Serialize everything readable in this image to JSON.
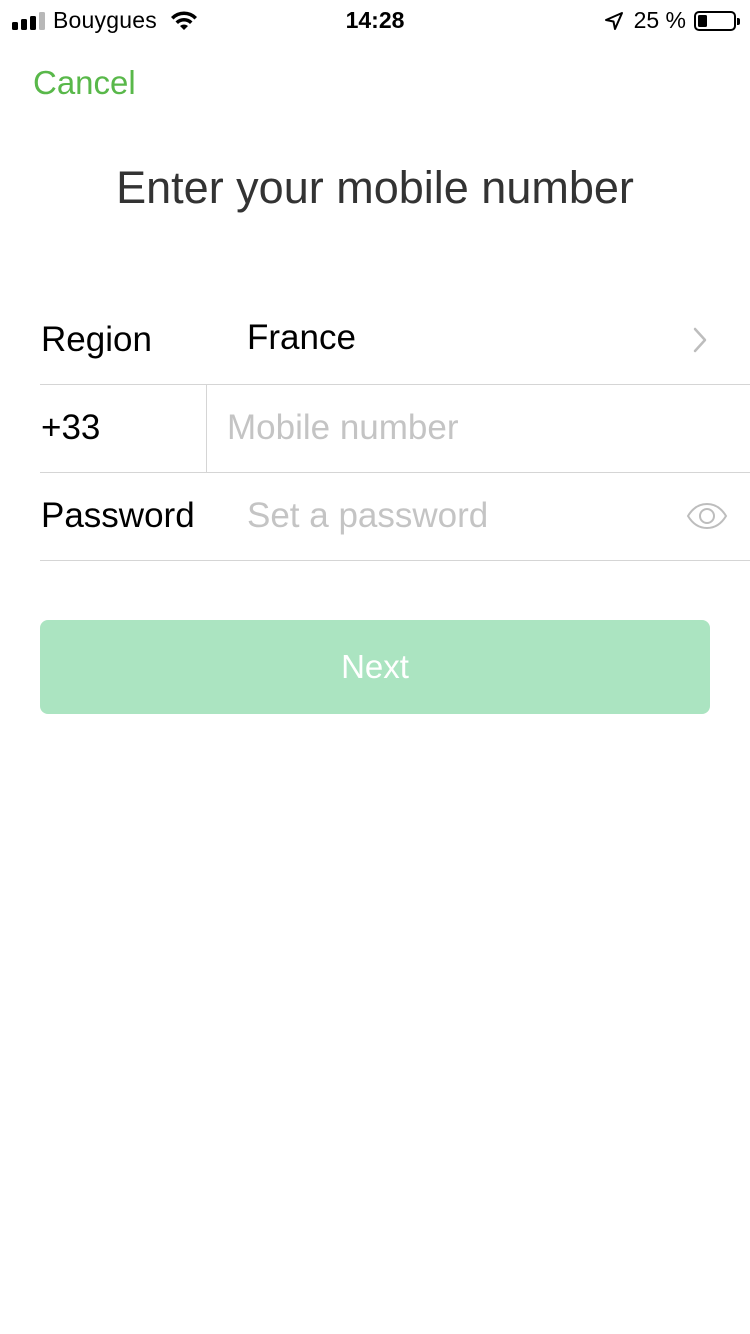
{
  "status_bar": {
    "carrier": "Bouygues",
    "time": "14:28",
    "battery_percent": "25 %",
    "battery_level": 0.25,
    "signal_bars_filled": 3,
    "signal_bars_total": 4,
    "icons": [
      "signal-icon",
      "wifi-icon",
      "location-arrow-icon",
      "battery-icon"
    ]
  },
  "nav": {
    "cancel_label": "Cancel"
  },
  "page": {
    "title": "Enter your mobile number"
  },
  "form": {
    "region": {
      "label": "Region",
      "value": "France"
    },
    "phone": {
      "country_code": "+33",
      "placeholder": "Mobile number",
      "value": ""
    },
    "password": {
      "label": "Password",
      "placeholder": "Set a password",
      "value": ""
    }
  },
  "actions": {
    "next_label": "Next"
  },
  "colors": {
    "accent": "#59b84a",
    "button_disabled": "#abe4c1",
    "title_text": "#333333",
    "placeholder": "#c4c4c4",
    "divider": "#d5d5d5"
  }
}
